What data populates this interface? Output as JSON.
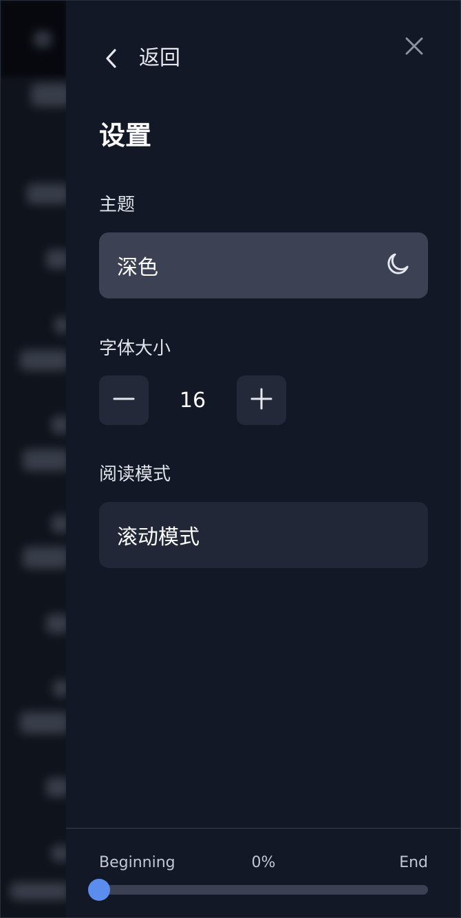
{
  "settings": {
    "back_label": "返回",
    "title": "设置",
    "theme": {
      "label": "主题",
      "value": "深色"
    },
    "font_size": {
      "label": "字体大小",
      "value": "16"
    },
    "reading_mode": {
      "label": "阅读模式",
      "value": "滚动模式"
    }
  },
  "icons": {
    "back": "chevron-left-icon",
    "close": "close-icon",
    "theme": "moon-icon",
    "decrease": "minus-icon",
    "increase": "plus-icon"
  },
  "progress": {
    "start_label": "Beginning",
    "percent_label": "0%",
    "end_label": "End",
    "value_fraction": 0.0
  },
  "colors": {
    "accent": "#5b8def",
    "panel": "#131826",
    "active_option": "#3c4253"
  }
}
